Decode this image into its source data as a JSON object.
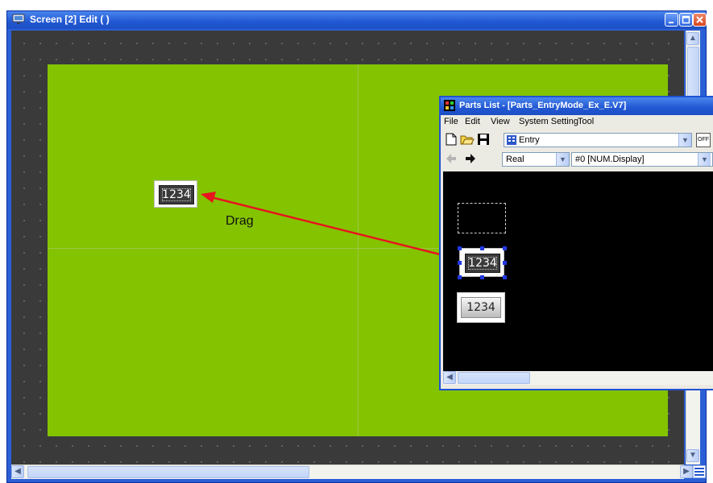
{
  "main_window": {
    "title": "Screen [2] Edit (               )",
    "title_icon": "monitor-icon"
  },
  "canvas": {
    "background_color": "#3a3a3a",
    "screen_color": "#84c300"
  },
  "placed_part": {
    "value": "1234"
  },
  "annotation": {
    "label": "Drag",
    "arrow_color": "#e8141e"
  },
  "parts_list": {
    "title": "Parts List - [Parts_EntryMode_Ex_E.V7]",
    "menu": [
      "File",
      "Edit",
      "View",
      "System Setting",
      "Tool"
    ],
    "mode_combo": "Entry",
    "type_combo": "Real",
    "part_combo": "#0 [NUM.Display]",
    "selected_part_value": "1234",
    "other_part_value": "1234"
  },
  "accent_color": "#2157d2"
}
